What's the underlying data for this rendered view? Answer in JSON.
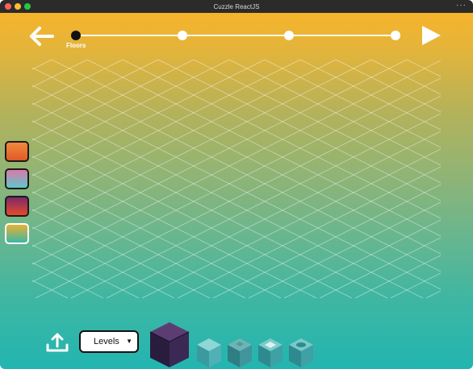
{
  "window": {
    "title": "Cuzzle ReactJS",
    "more": "···"
  },
  "toolbar": {
    "back_icon": "arrow-left-icon",
    "play_icon": "play-icon"
  },
  "progress": {
    "steps": 4,
    "active_index": 0,
    "active_label": "Floors"
  },
  "palette": [
    {
      "name": "orange-sunset",
      "colors": [
        "#f08a3a",
        "#e05a2a"
      ],
      "selected": false
    },
    {
      "name": "pink-teal",
      "colors": [
        "#d97aa8",
        "#5ec8cc"
      ],
      "selected": false
    },
    {
      "name": "purple-red",
      "colors": [
        "#7a2a6a",
        "#e6482a"
      ],
      "selected": false
    },
    {
      "name": "yellow-teal",
      "colors": [
        "#e8b232",
        "#3cb6a6"
      ],
      "selected": true
    }
  ],
  "bottom": {
    "upload_icon": "upload-icon",
    "dropdown": {
      "value": "Levels"
    },
    "blocks": [
      "dark-cube",
      "teal-cube",
      "teal-cube-dark",
      "teal-cube-window",
      "teal-cube-round"
    ]
  }
}
